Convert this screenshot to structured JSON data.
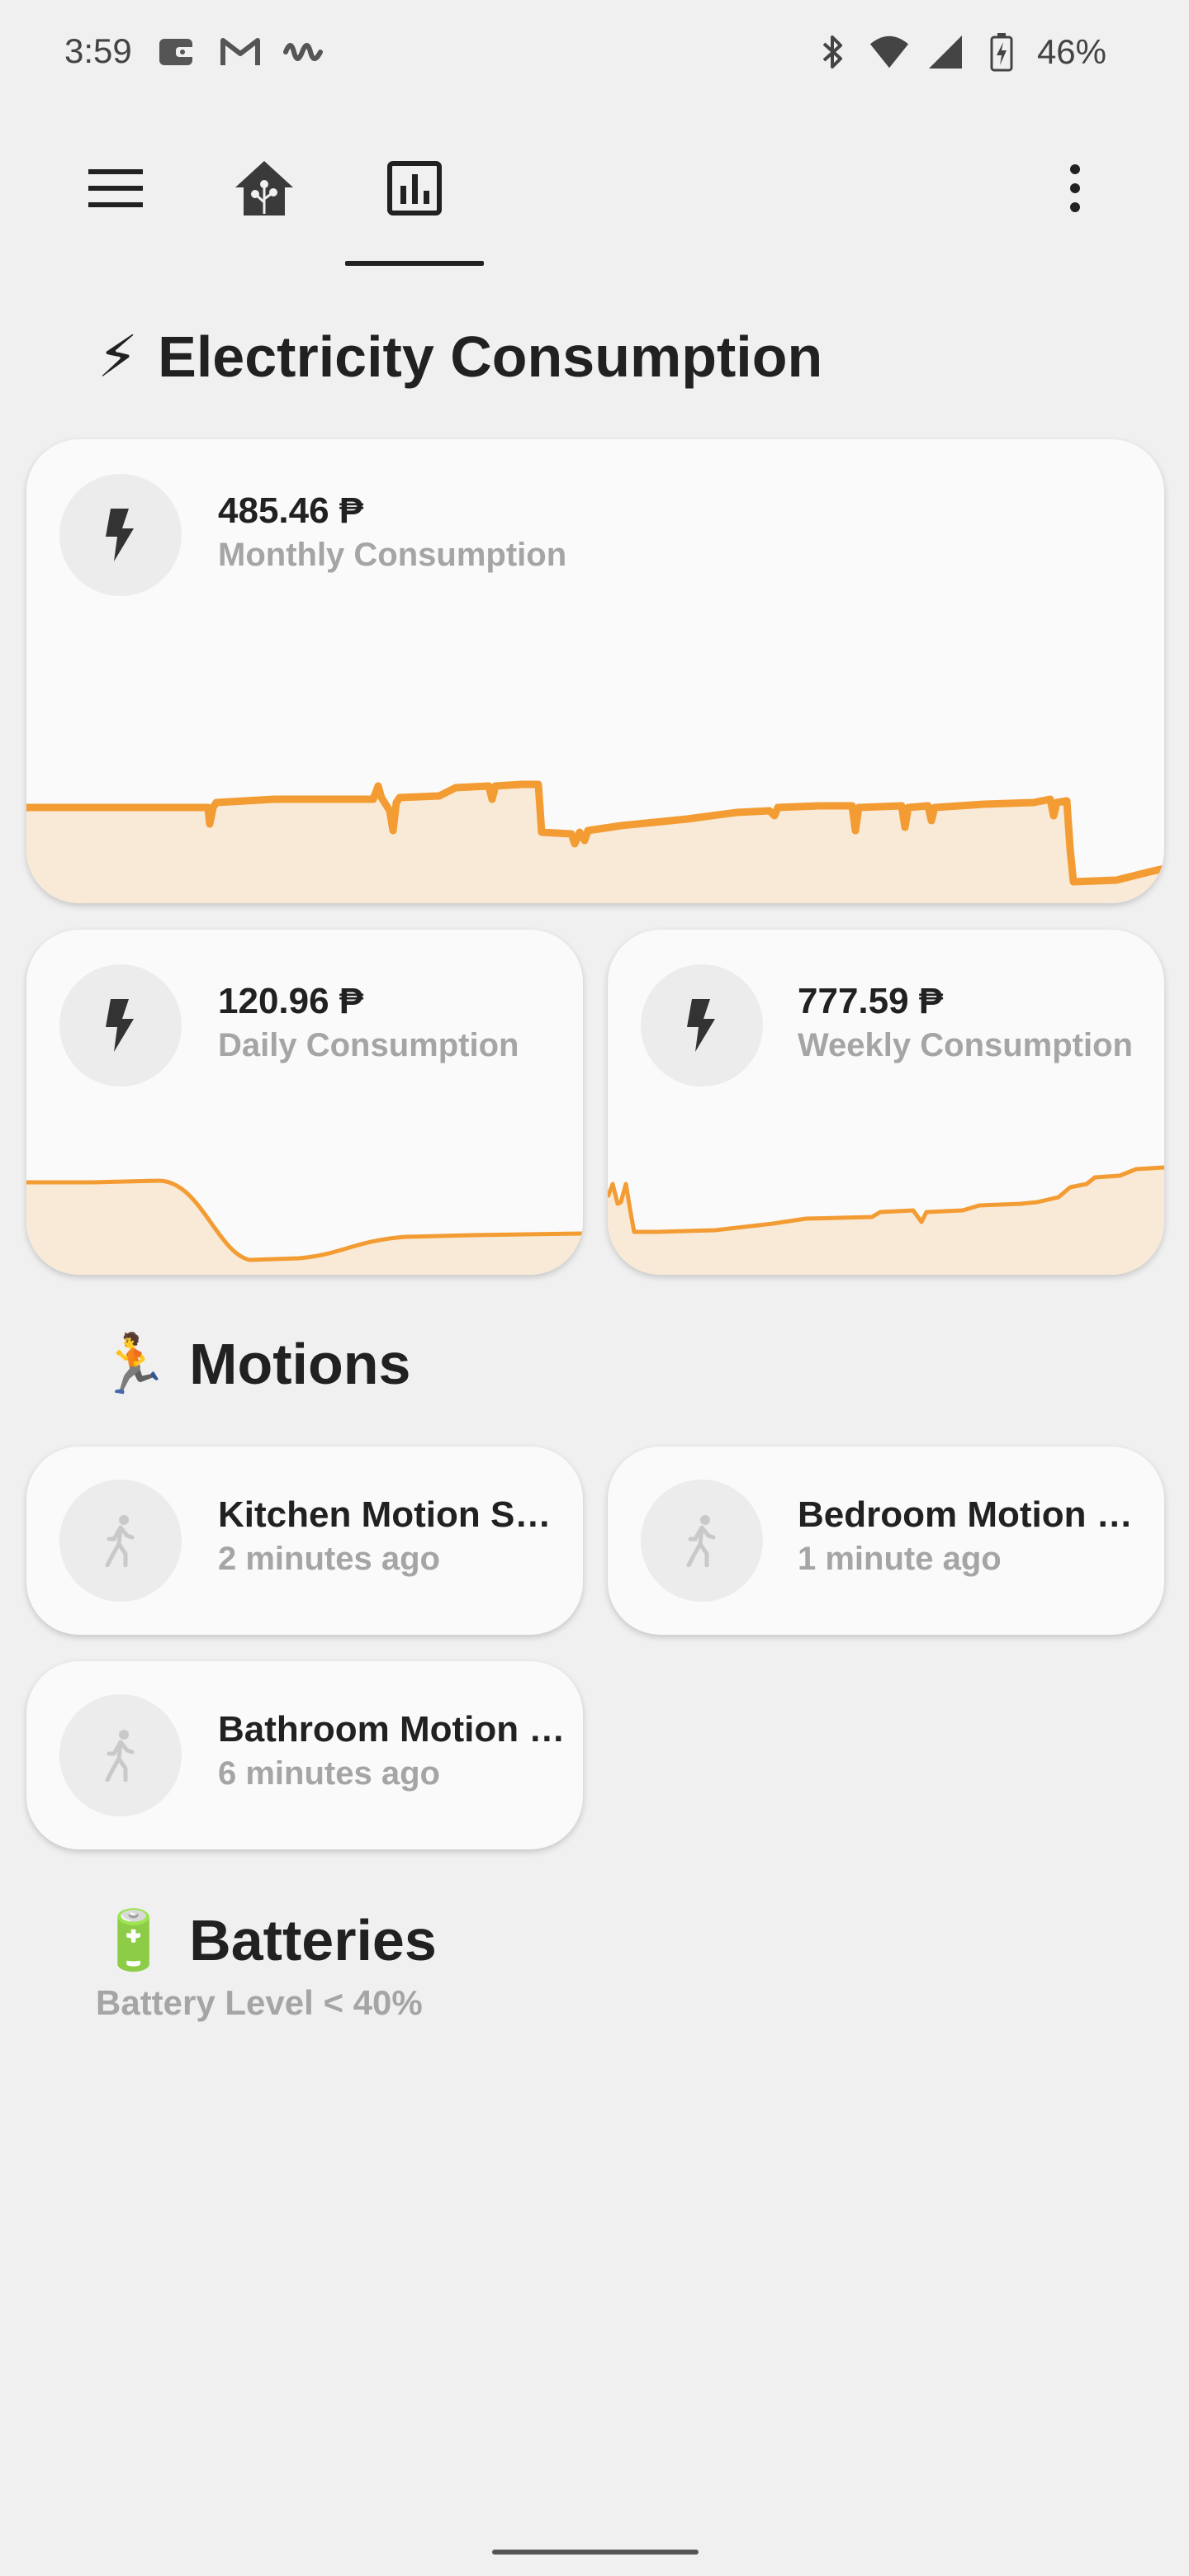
{
  "status_bar": {
    "time": "3:59",
    "battery_percent": "46%",
    "left_icons": [
      "wallet-icon",
      "gmail-icon",
      "waveform-icon"
    ],
    "right_icons": [
      "bluetooth-icon",
      "wifi-icon",
      "signal-icon",
      "battery-charging-icon"
    ]
  },
  "toolbar": {
    "menu_icon": "hamburger-icon",
    "tabs": [
      {
        "icon": "home-assistant-icon",
        "selected": false
      },
      {
        "icon": "bar-chart-icon",
        "selected": true
      }
    ],
    "overflow_icon": "more-vertical-icon"
  },
  "sections": {
    "electricity": {
      "emoji": "⚡",
      "title": "Electricity Consumption"
    },
    "motions": {
      "emoji": "🏃",
      "title": "Motions"
    },
    "batteries": {
      "emoji": "🔋",
      "title": "Batteries",
      "subtitle": "Battery Level < 40%"
    }
  },
  "energy_cards": {
    "monthly": {
      "value": "485.46 ₱",
      "label": "Monthly Consumption",
      "icon": "lightning-bolt-icon"
    },
    "daily": {
      "value": "120.96 ₱",
      "label": "Daily Consumption",
      "icon": "lightning-bolt-icon"
    },
    "weekly": {
      "value": "777.59 ₱",
      "label": "Weekly Consumption",
      "icon": "lightning-bolt-icon"
    }
  },
  "motion_cards": [
    {
      "name": "Kitchen Motion Se…",
      "state": "2 minutes ago",
      "icon": "walking-person-icon"
    },
    {
      "name": "Bedroom Motion …",
      "state": "1 minute ago",
      "icon": "walking-person-icon"
    },
    {
      "name": "Bathroom Motion …",
      "state": "6 minutes ago",
      "icon": "walking-person-icon"
    }
  ],
  "colors": {
    "accent_line": "#f39c33",
    "fill": "#f8ead7",
    "background": "#f0f0f0",
    "card": "#fafafa"
  },
  "chart_data": [
    {
      "type": "area",
      "title": "",
      "xlabel": "",
      "ylabel": "",
      "grid": false,
      "series": [
        {
          "values": [
            60,
            60,
            60,
            60,
            60,
            60,
            60,
            60,
            60,
            60,
            60,
            60,
            60,
            60,
            60,
            60,
            60,
            60,
            60,
            60,
            60,
            60,
            60,
            60,
            60,
            60,
            60,
            60,
            60,
            60,
            60,
            60,
            60,
            60,
            60,
            60,
            60,
            60,
            60,
            60,
            60,
            60,
            60,
            60,
            60,
            60,
            60,
            60,
            60,
            60,
            60,
            60,
            60,
            60,
            60,
            60,
            60,
            60,
            60,
            60,
            60,
            60,
            60,
            60,
            60,
            60,
            60,
            60,
            60,
            60,
            60,
            60,
            60,
            60,
            60,
            60,
            60,
            60,
            60,
            60,
            60,
            60,
            60,
            60,
            60,
            60,
            60,
            60,
            60,
            60,
            60,
            60,
            60,
            60,
            60,
            60,
            60,
            60,
            60,
            60,
            60,
            60,
            60,
            60,
            60,
            60,
            60,
            60,
            60,
            60,
            60,
            60,
            60,
            60,
            60,
            60,
            60,
            60,
            60,
            60,
            60,
            60,
            60,
            60,
            60,
            60,
            60,
            60,
            60,
            60,
            60,
            60,
            60,
            60,
            60,
            60,
            60,
            60,
            60,
            60,
            60,
            60,
            60,
            60,
            60,
            60,
            60,
            60,
            60,
            60,
            60,
            60,
            60,
            60,
            60,
            60,
            60,
            60,
            60,
            60,
            60,
            60,
            60,
            60,
            60,
            60,
            60,
            60,
            60,
            60,
            60,
            60,
            60,
            60,
            60,
            60,
            60,
            60,
            60,
            60,
            60,
            60,
            60,
            60,
            60,
            60,
            60,
            60,
            60,
            60,
            60,
            60,
            60,
            60,
            60,
            60,
            60,
            60,
            60,
            60,
            60,
            60,
            60,
            60,
            60,
            60,
            60,
            60,
            60,
            60,
            60,
            60,
            60,
            60,
            60,
            60,
            60,
            60,
            60,
            60,
            60,
            60,
            60,
            60,
            60,
            60,
            60,
            60,
            60,
            60,
            60,
            60,
            60,
            60,
            60,
            60,
            60,
            60,
            60,
            60,
            60,
            60,
            60,
            60
          ]
        }
      ]
    },
    {
      "type": "area",
      "title": "",
      "xlabel": "",
      "ylabel": "",
      "grid": false,
      "series": [
        {
          "values": [
            80,
            80,
            80,
            80,
            80,
            80,
            80,
            80,
            80,
            80,
            80,
            80,
            80,
            80,
            80,
            80,
            80,
            80,
            80,
            80,
            80,
            80,
            80,
            80,
            80,
            80,
            80,
            80
          ]
        }
      ]
    },
    {
      "type": "area",
      "title": "",
      "xlabel": "",
      "ylabel": "",
      "grid": false,
      "series": [
        {
          "values": [
            80,
            80,
            80,
            80,
            80,
            80,
            80,
            80,
            80,
            80,
            80,
            80,
            80,
            80,
            80,
            80,
            80,
            80,
            80,
            80,
            80,
            80,
            80,
            80,
            80,
            80,
            80,
            80
          ]
        }
      ]
    }
  ]
}
